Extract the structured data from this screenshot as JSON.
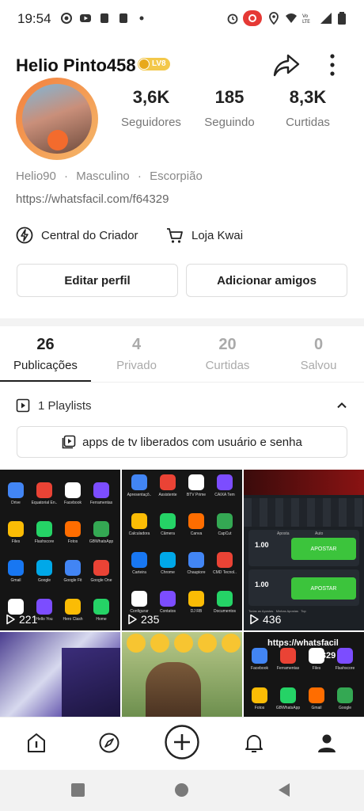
{
  "status_bar": {
    "time": "19:54"
  },
  "profile": {
    "username": "Helio Pinto458",
    "level_badge": "LV8",
    "stats": [
      {
        "value": "3,6K",
        "label": "Seguidores"
      },
      {
        "value": "185",
        "label": "Seguindo"
      },
      {
        "value": "8,3K",
        "label": "Curtidas"
      }
    ],
    "meta": [
      "Helio90",
      "·",
      "Masculino",
      "·",
      "Escorpião"
    ],
    "link": "https://whatsfacil.com/f64329",
    "features": {
      "creator": "Central do Criador",
      "shop": "Loja Kwai"
    },
    "buttons": {
      "edit": "Editar perfil",
      "add_friends": "Adicionar amigos"
    }
  },
  "tabs": [
    {
      "count": "26",
      "label": "Publicações"
    },
    {
      "count": "4",
      "label": "Privado"
    },
    {
      "count": "20",
      "label": "Curtidas"
    },
    {
      "count": "0",
      "label": "Salvou"
    }
  ],
  "playlists": {
    "header": "1 Playlists",
    "item": "apps de tv liberados com usuário e senha"
  },
  "grid": {
    "tile1": {
      "views": "221",
      "apps": [
        "Drive",
        "Equatorial En..",
        "Facebook",
        "Ferramentas",
        "Files",
        "Flashscore",
        "Fotos",
        "GBWhatsApp",
        "Gmail",
        "Google",
        "Google Fit",
        "Google One",
        "",
        "Hello You",
        "Hero Clash",
        "Home"
      ]
    },
    "tile2": {
      "views": "235",
      "apps": [
        "Apresentaçõ..",
        "Assistente",
        "BTV Prime",
        "CAIXA Tem",
        "Calculadora",
        "Câmera",
        "Canva",
        "CapCut",
        "Carteira",
        "Chrome",
        "Chaupiore",
        "CMD Tecnol..",
        "Configurar",
        "Contatos",
        "DJ RB",
        "Documentos"
      ]
    },
    "tile3": {
      "views": "436",
      "odds": [
        "1.00",
        "1.00"
      ],
      "bet_label": "APOSTAR",
      "bet_header": "Aposta",
      "auto_header": "Auto",
      "footer": [
        "Todas as Apostas",
        "Minhas Apostas",
        "Top"
      ]
    },
    "tile6": {
      "overlay": "https://whatsfacil",
      "overlay2": "f64329",
      "apps": [
        "Facebook",
        "Ferramentas",
        "Files",
        "Flashscore",
        "Fotos",
        "GBWhatsApp",
        "Gmail",
        "Google"
      ]
    }
  },
  "colors": {
    "accent_orange": "#f36b2d",
    "bet_green": "#3cc43c",
    "badge_gold": "#f3c84a"
  }
}
